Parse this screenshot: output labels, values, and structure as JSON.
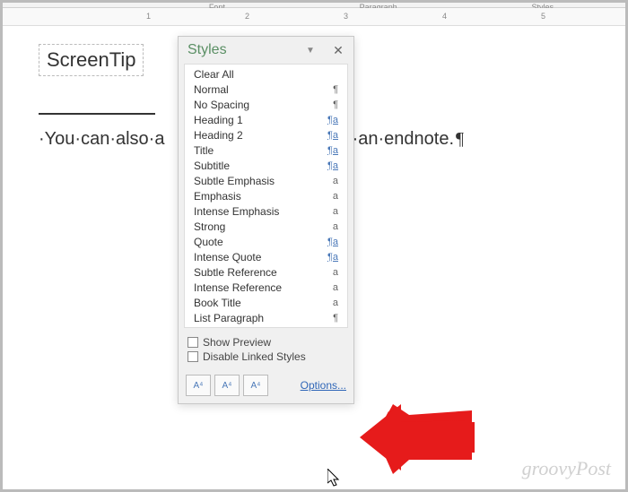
{
  "ribbon": {
    "group_font": "Font",
    "group_para": "Paragraph",
    "group_styles": "Styles"
  },
  "ruler": {
    "marks": [
      "1",
      "2",
      "3",
      "4",
      "5"
    ]
  },
  "doc": {
    "screentip": "ScreenTip",
    "body_left": "·You·can·also·a",
    "body_right": "g·an·endnote.",
    "pilcrow": "¶"
  },
  "pane": {
    "title": "Styles",
    "styles": [
      {
        "label": "Clear All",
        "mark": "",
        "mtype": "none"
      },
      {
        "label": "Normal",
        "mark": "¶",
        "mtype": "plain"
      },
      {
        "label": "No Spacing",
        "mark": "¶",
        "mtype": "plain"
      },
      {
        "label": "Heading 1",
        "mark": "¶a",
        "mtype": "link"
      },
      {
        "label": "Heading 2",
        "mark": "¶a",
        "mtype": "link"
      },
      {
        "label": "Title",
        "mark": "¶a",
        "mtype": "link"
      },
      {
        "label": "Subtitle",
        "mark": "¶a",
        "mtype": "link"
      },
      {
        "label": "Subtle Emphasis",
        "mark": "a",
        "mtype": "plain"
      },
      {
        "label": "Emphasis",
        "mark": "a",
        "mtype": "plain"
      },
      {
        "label": "Intense Emphasis",
        "mark": "a",
        "mtype": "plain"
      },
      {
        "label": "Strong",
        "mark": "a",
        "mtype": "plain"
      },
      {
        "label": "Quote",
        "mark": "¶a",
        "mtype": "link"
      },
      {
        "label": "Intense Quote",
        "mark": "¶a",
        "mtype": "link"
      },
      {
        "label": "Subtle Reference",
        "mark": "a",
        "mtype": "plain"
      },
      {
        "label": "Intense Reference",
        "mark": "a",
        "mtype": "plain"
      },
      {
        "label": "Book Title",
        "mark": "a",
        "mtype": "plain"
      },
      {
        "label": "List Paragraph",
        "mark": "¶",
        "mtype": "plain"
      }
    ],
    "show_preview": "Show Preview",
    "disable_linked": "Disable Linked Styles",
    "options": "Options...",
    "btn1": "A⁴",
    "btn2": "A⁴",
    "btn3": "A⁴"
  },
  "watermark": "groovyPost"
}
